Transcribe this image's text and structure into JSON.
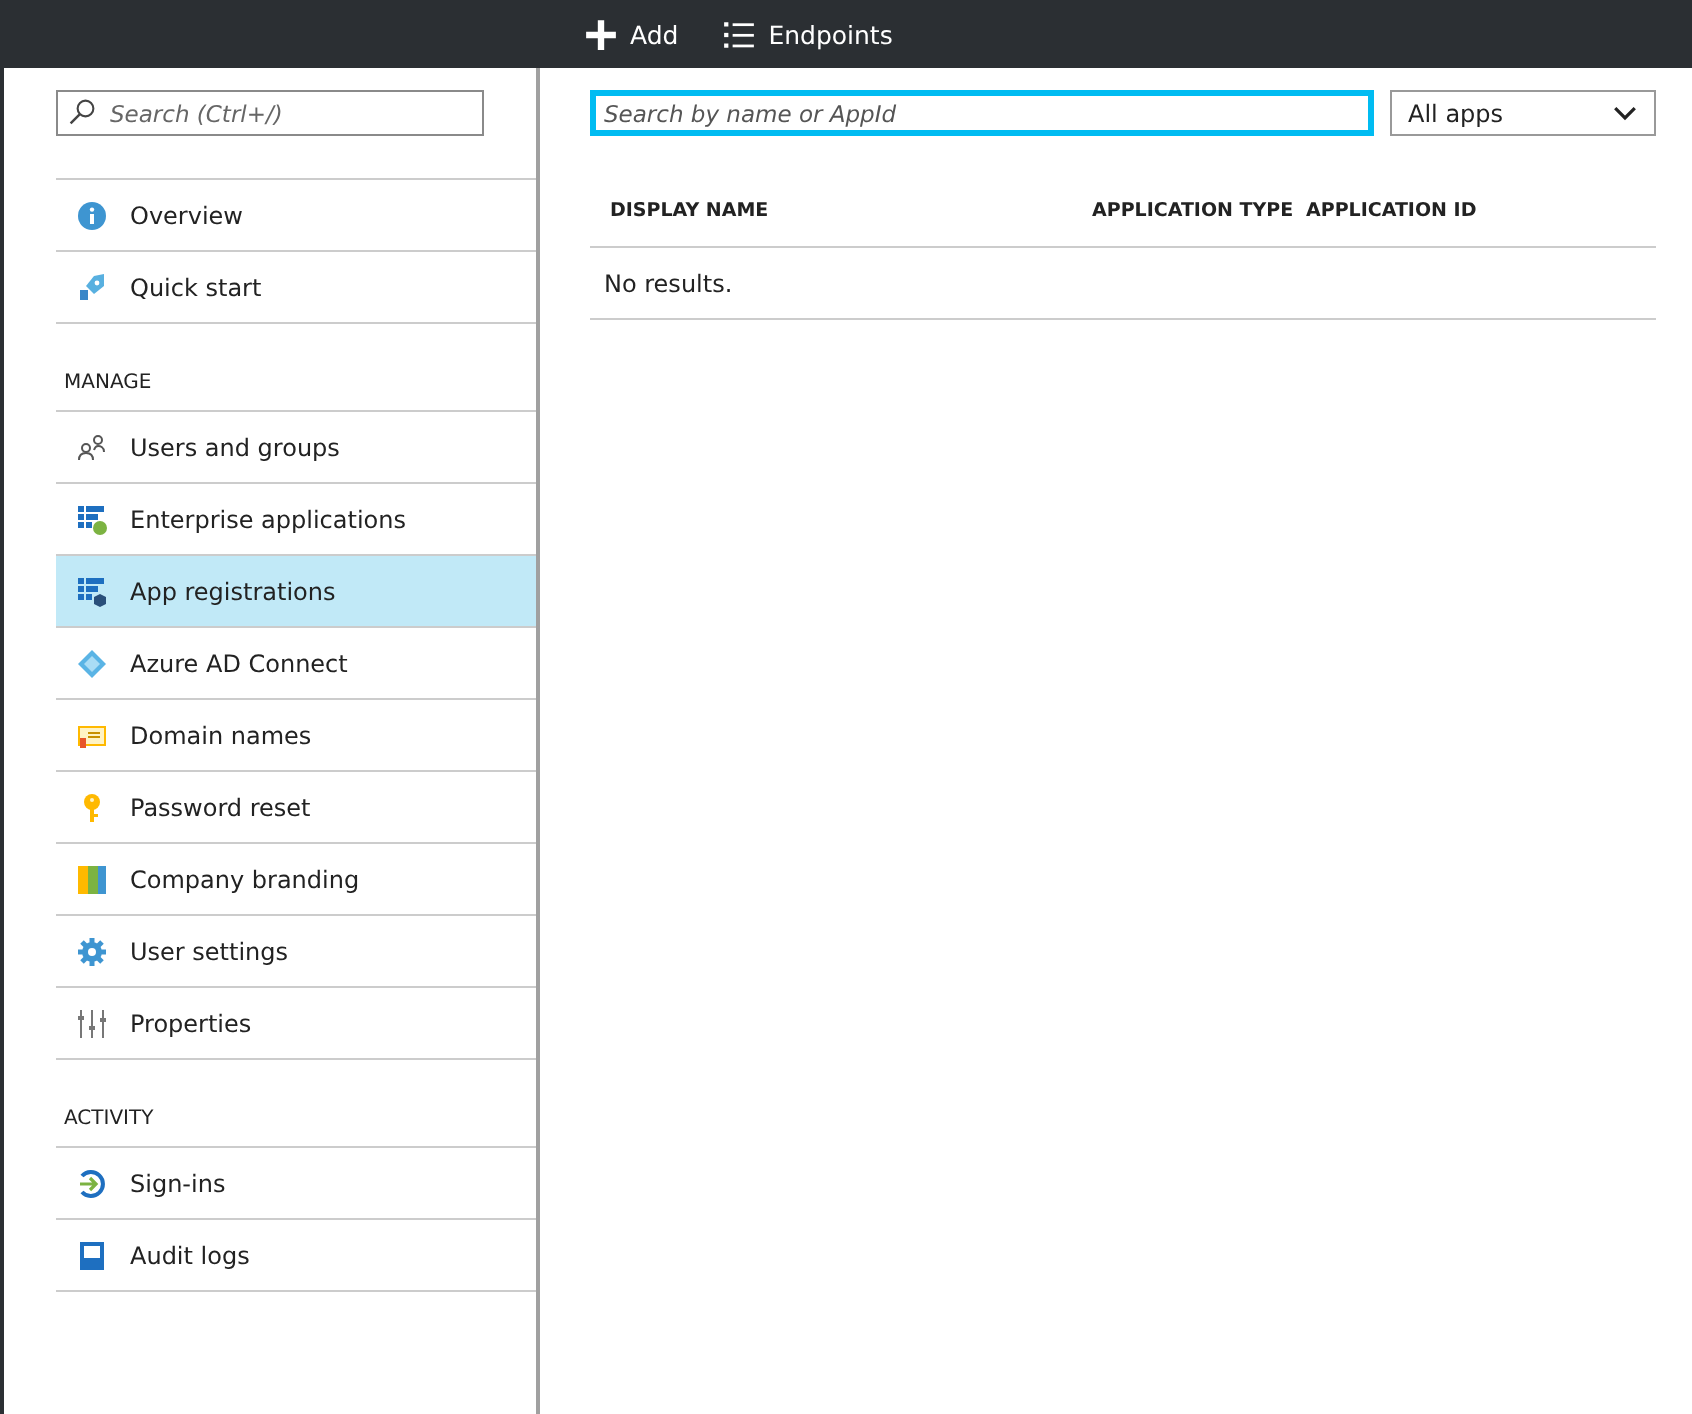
{
  "command_bar": {
    "buttons": [
      {
        "label": "Add"
      },
      {
        "label": "Endpoints"
      }
    ]
  },
  "sidebar": {
    "search": {
      "placeholder": "Search (Ctrl+/)"
    },
    "sections": [
      {
        "items": [
          {
            "label": "Overview",
            "selected": false
          },
          {
            "label": "Quick start",
            "selected": false
          }
        ]
      },
      {
        "heading": "MANAGE",
        "items": [
          {
            "label": "Users and groups",
            "selected": false
          },
          {
            "label": "Enterprise applications",
            "selected": false
          },
          {
            "label": "App registrations",
            "selected": true
          },
          {
            "label": "Azure AD Connect",
            "selected": false
          },
          {
            "label": "Domain names",
            "selected": false
          },
          {
            "label": "Password reset",
            "selected": false
          },
          {
            "label": "Company branding",
            "selected": false
          },
          {
            "label": "User settings",
            "selected": false
          },
          {
            "label": "Properties",
            "selected": false
          }
        ]
      },
      {
        "heading": "ACTIVITY",
        "items": [
          {
            "label": "Sign-ins",
            "selected": false
          },
          {
            "label": "Audit logs",
            "selected": false
          }
        ]
      }
    ]
  },
  "main": {
    "search": {
      "placeholder": "Search by name or AppId"
    },
    "filter": {
      "value": "All apps"
    },
    "table": {
      "columns": [
        "DISPLAY NAME",
        "APPLICATION TYPE",
        "APPLICATION ID"
      ],
      "empty_message": "No results."
    }
  }
}
